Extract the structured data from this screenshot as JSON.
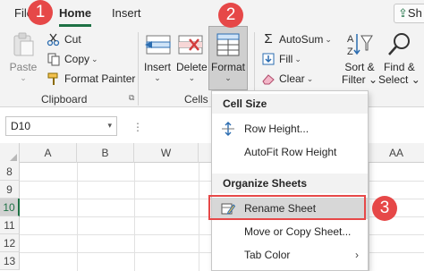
{
  "tabs": {
    "file": "File",
    "home": "Home",
    "insert": "Insert",
    "share": "Sh"
  },
  "clipboard": {
    "paste": "Paste",
    "cut": "Cut",
    "copy": "Copy",
    "format_painter": "Format Painter",
    "group_label": "Clipboard"
  },
  "cells": {
    "insert": "Insert",
    "delete": "Delete",
    "format": "Format",
    "group_label": "Cells"
  },
  "editing": {
    "autosum": "AutoSum",
    "fill": "Fill",
    "clear": "Clear",
    "sort_filter_line1": "Sort &",
    "sort_filter_line2": "Filter",
    "find_select_line1": "Find &",
    "find_select_line2": "Select"
  },
  "badges": {
    "one": "1",
    "two": "2",
    "three": "3"
  },
  "namebox": {
    "value": "D10"
  },
  "formula_dots": "⋮",
  "grid": {
    "columns": [
      "A",
      "B",
      "W",
      "AA"
    ],
    "rows": [
      "8",
      "9",
      "10",
      "11",
      "12",
      "13"
    ],
    "active_row": "10"
  },
  "menu": {
    "cell_size_heading": "Cell Size",
    "row_height": "Row Height...",
    "autofit_row_height": "AutoFit Row Height",
    "organize_heading": "Organize Sheets",
    "rename_sheet": "Rename Sheet",
    "move_copy_sheet": "Move or Copy Sheet...",
    "tab_color": "Tab Color",
    "tab_color_arrow": "›"
  },
  "colors": {
    "accent": "#1e7145",
    "badge": "#e64848",
    "highlight_border": "#e64848"
  }
}
